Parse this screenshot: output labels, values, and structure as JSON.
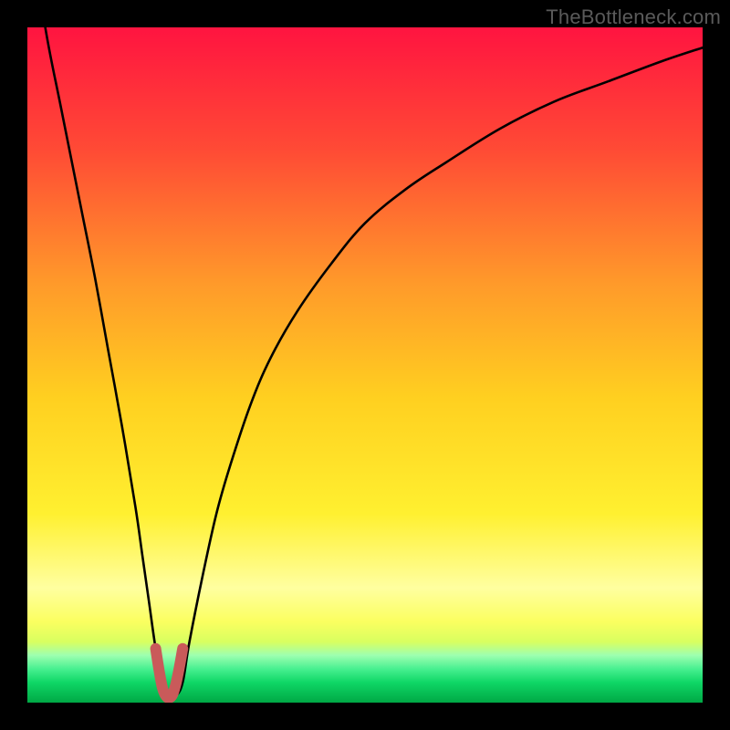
{
  "watermark": "TheBottleneck.com",
  "colors": {
    "frame": "#000000",
    "gradient_top": "#ff1440",
    "gradient_upper_mid": "#ff7a2a",
    "gradient_mid": "#ffc22a",
    "gradient_lower_mid": "#ffee3a",
    "gradient_near_bottom_light": "#ffff9a",
    "gradient_near_bottom_yellow": "#f6ff40",
    "gradient_green_band_light": "#7dffb0",
    "gradient_green": "#00e060",
    "gradient_green_deep": "#00a040",
    "curve_stroke": "#000000",
    "highlight_stroke": "#c95a5a"
  },
  "chart_data": {
    "type": "line",
    "title": "",
    "xlabel": "",
    "ylabel": "",
    "xlim": [
      0,
      100
    ],
    "ylim": [
      0,
      100
    ],
    "series": [
      {
        "name": "bottleneck-curve",
        "x": [
          1,
          3,
          5,
          8,
          10,
          12,
          14,
          16,
          17,
          18,
          19,
          20,
          21,
          22,
          23,
          24,
          26,
          28,
          30,
          33,
          36,
          40,
          45,
          50,
          56,
          62,
          70,
          78,
          86,
          94,
          100
        ],
        "y": [
          110,
          98,
          88,
          73,
          63,
          52,
          41,
          29,
          22,
          15,
          8,
          3,
          1,
          1,
          3,
          9,
          19,
          28,
          35,
          44,
          51,
          58,
          65,
          71,
          76,
          80,
          85,
          89,
          92,
          95,
          97
        ]
      }
    ],
    "highlight": {
      "name": "minimum-region",
      "x": [
        19,
        19.5,
        20,
        20.5,
        21,
        21.5,
        22,
        22.5,
        23
      ],
      "y": [
        8,
        4.8,
        2.2,
        1.0,
        0.7,
        1.2,
        2.8,
        5.2,
        8
      ]
    },
    "notes": "Values are unlabeled in the source image; x and y are read as 0–100 relative units from the plot area. The curve depicts a sharp dip to ~0 near x≈21 and asymptotically rises toward the upper right."
  }
}
